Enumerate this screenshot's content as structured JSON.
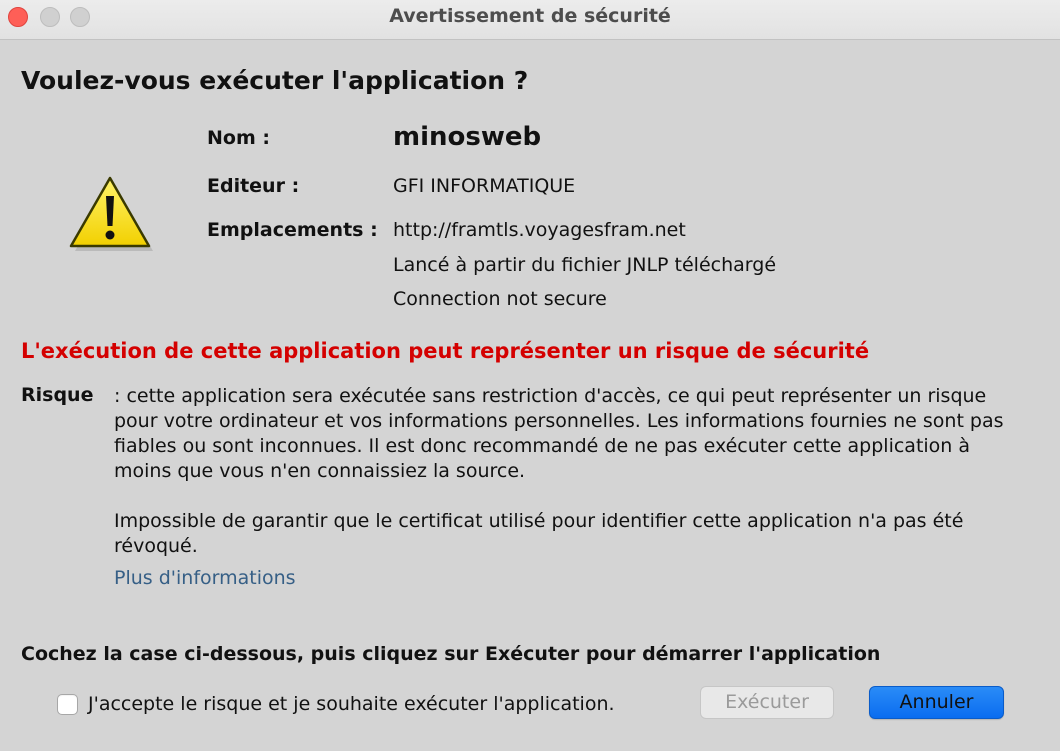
{
  "window": {
    "title": "Avertissement de sécurité"
  },
  "dialog": {
    "question": "Voulez-vous exécuter l'application ?",
    "fields": {
      "name_label": "Nom :",
      "name_value": "minosweb",
      "publisher_label": "Editeur :",
      "publisher_value": "GFI INFORMATIQUE",
      "locations_label": "Emplacements :",
      "location_1": "http://framtls.voyagesfram.net",
      "location_2": "Lancé à partir du fichier JNLP téléchargé",
      "location_3": "Connection not secure"
    },
    "warning_icon": "warning-triangle-icon",
    "risk_title": "L'exécution de cette application peut représenter un risque de sécurité",
    "risk_label": "Risque",
    "risk_text": ": cette application sera exécutée sans restriction d'accès, ce qui peut représenter un risque",
    "risk_text_lines": [
      "pour votre ordinateur et vos informations personnelles. Les informations fournies ne sont pas",
      "fiables ou sont inconnues. Il est donc recommandé de ne pas exécuter cette application à",
      "moins que vous n'en connaissiez la source."
    ],
    "certificate_line_1": "Impossible de garantir que le certificat utilisé pour identifier cette application n'a pas été",
    "certificate_line_2": "révoqué.",
    "more_info_link": "Plus d'informations",
    "instruction": "Cochez la case ci-dessous, puis cliquez sur Exécuter pour démarrer l'application",
    "accept_checkbox_label": "J'accepte le risque et je souhaite exécuter l'application.",
    "accept_checked": false,
    "run_button": "Exécuter",
    "cancel_button": "Annuler"
  },
  "colors": {
    "risk_title": "#d40000",
    "link": "#365f86",
    "primary_button": "#0a6df0",
    "close_button": "#fe5f57"
  }
}
